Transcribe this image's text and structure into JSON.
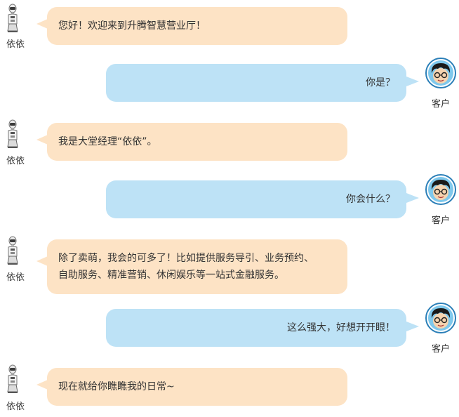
{
  "robot": {
    "name": "依依"
  },
  "user": {
    "name": "客户"
  },
  "messages": [
    {
      "from": "robot",
      "text": "您好！欢迎来到升腾智慧营业厅！"
    },
    {
      "from": "user",
      "text": "你是？"
    },
    {
      "from": "robot",
      "text": "我是大堂经理“依依”。"
    },
    {
      "from": "user",
      "text": "你会什么？"
    },
    {
      "from": "robot",
      "lines": [
        "除了卖萌，我会的可多了！比如提供服务导引、业务预约、",
        "自助服务、精准营销、休闲娱乐等一站式金融服务。"
      ]
    },
    {
      "from": "user",
      "text": "这么强大，好想开开眼！"
    },
    {
      "from": "robot",
      "text": "现在就给你瞧瞧我的日常~"
    }
  ],
  "colors": {
    "robot_bubble": "#fde3c5",
    "user_bubble": "#bde2f6"
  },
  "icons": {
    "robot_avatar": "robot-avatar-icon",
    "user_avatar": "user-avatar-icon"
  }
}
